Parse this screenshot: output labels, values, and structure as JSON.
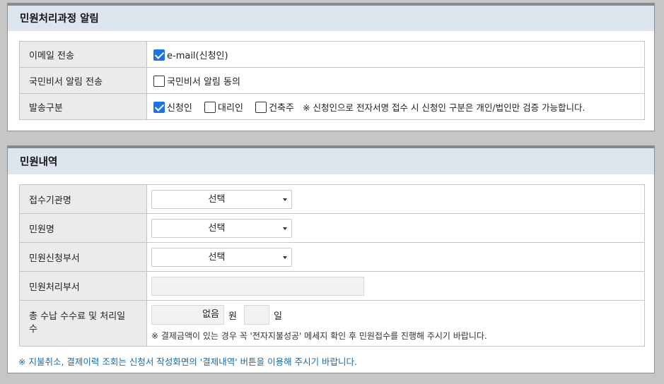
{
  "notify": {
    "title": "민원처리과정 알림",
    "rows": [
      {
        "label": "이메일 전송",
        "options": [
          {
            "label": "e-mail(신청인)",
            "checked": true
          }
        ]
      },
      {
        "label": "국민비서 알림 전송",
        "options": [
          {
            "label": "국민비서 알림 동의",
            "checked": false
          }
        ]
      },
      {
        "label": "발송구분",
        "options": [
          {
            "label": "신청인",
            "checked": true
          },
          {
            "label": "대리인",
            "checked": false
          },
          {
            "label": "건축주",
            "checked": false
          }
        ],
        "note": "※ 신청인으로 전자서명 접수 시 신청인 구분은 개인/법인만 검증 가능합니다."
      }
    ]
  },
  "petition": {
    "title": "민원내역",
    "rows": [
      {
        "label": "접수기관명",
        "select": "선택"
      },
      {
        "label": "민원명",
        "select": "선택"
      },
      {
        "label": "민원신청부서",
        "select": "선택"
      },
      {
        "label": "민원처리부서"
      },
      {
        "label": "총 수납 수수료 및 처리일수"
      }
    ],
    "fee": {
      "value": "없음",
      "unit_won": "원",
      "days_value": "",
      "unit_day": "일",
      "note": "※ 결제금액이 있는 경우 꼭 '전자지불성공' 메세지 확인 후 민원접수를 진행해 주시기 바랍니다."
    },
    "bottom_note": "※ 지불취소, 결제이력 조회는 신청서 작성화면의 '결제내역' 버튼을 이용해 주시기 바랍니다."
  },
  "colors": {
    "accent_checkbox": "#1a73e8",
    "header_bg": "#dde6ee",
    "note_blue": "#1b6aa5"
  }
}
